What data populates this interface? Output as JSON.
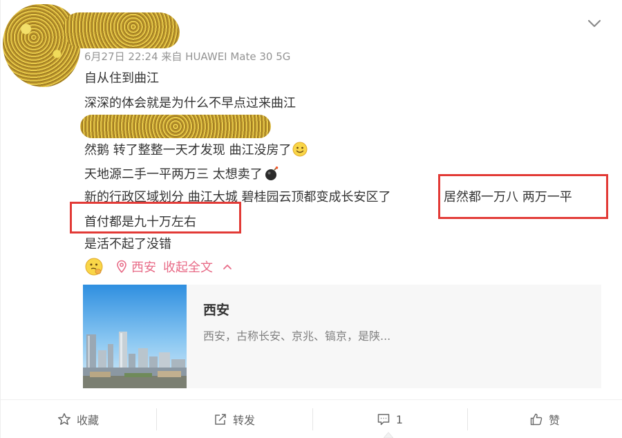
{
  "post": {
    "meta": "6月27日 22:24 来自 HUAWEI Mate 30 5G",
    "lines": [
      "自从住到曲江",
      "深深的体会就是为什么不早点过来曲江",
      "然鹅 转了整整一天才发现 曲江没房了",
      "天地源二手一平两万三 太想卖了",
      "新的行政区域划分 曲江大城 碧桂园云顶都变成长安区了",
      "居然都一万八 两万一平",
      "首付都是九十万左右",
      "是活不起了没错"
    ],
    "location": "西安",
    "collapse_label": "收起全文"
  },
  "link_card": {
    "title": "西安",
    "description": "西安，古称长安、京兆、镐京，是陕..."
  },
  "actions": {
    "favorite": "收藏",
    "repost": "转发",
    "comment_count": "1",
    "like": "赞"
  },
  "colors": {
    "highlight": "#e23a36",
    "location": "#e86b87",
    "meta": "#939393"
  }
}
